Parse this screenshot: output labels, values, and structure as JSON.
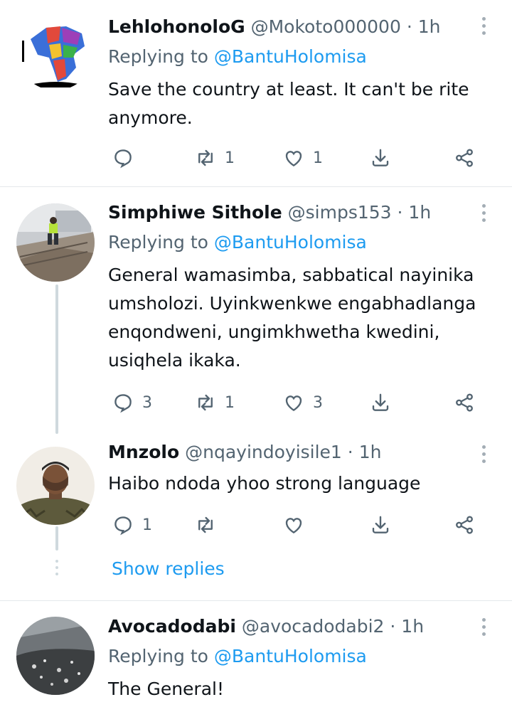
{
  "tweets": [
    {
      "name": "LehlohonoloG",
      "handle": "@Mokoto000000",
      "sep": "·",
      "time": "1h",
      "replying_prefix": "Replying to",
      "replying_to": "@BantuHolomisa",
      "text": "Save the country at least. It can't be rite anymore.",
      "reply_count": "",
      "retweet_count": "1",
      "like_count": "1"
    },
    {
      "name": "Simphiwe Sithole",
      "handle": "@simps153",
      "sep": "·",
      "time": "1h",
      "replying_prefix": "Replying to",
      "replying_to": "@BantuHolomisa",
      "text": "General wamasimba, sabbatical nayinika umsholozi. Uyinkwenkwe engabhadlanga enqondweni, ungimkhwetha kwedini, usiqhela ikaka.",
      "reply_count": "3",
      "retweet_count": "1",
      "like_count": "3"
    },
    {
      "name": "Mnzolo",
      "handle": "@nqayindoyisile1",
      "sep": "·",
      "time": "1h",
      "text": "Haibo ndoda yhoo strong language",
      "reply_count": "1",
      "retweet_count": "",
      "like_count": ""
    },
    {
      "name": "Avocadodabi",
      "handle": "@avocadodabi2",
      "sep": "·",
      "time": "1h",
      "replying_prefix": "Replying to",
      "replying_to": "@BantuHolomisa",
      "text": "The General!"
    }
  ],
  "show_replies": "Show replies",
  "icons": {
    "reply": "reply-icon",
    "retweet": "retweet-icon",
    "like": "like-icon",
    "bookmark": "bookmark-icon",
    "share": "share-icon",
    "more": "more-icon"
  },
  "colors": {
    "accent": "#1d9bf0",
    "secondary_text": "#536471",
    "primary_text": "#0f1419"
  }
}
